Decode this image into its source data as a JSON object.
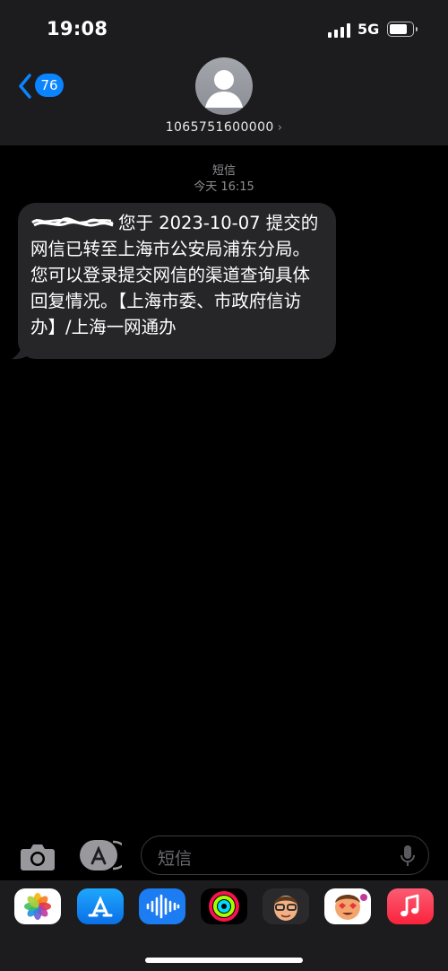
{
  "status_bar": {
    "time": "19:08",
    "network": "5G",
    "battery_level": 0.82
  },
  "nav": {
    "back_count": "76",
    "contact": "1065751600000",
    "contact_chevron": "›"
  },
  "thread": {
    "service": "短信",
    "timestamp": "今天 16:15",
    "message": "您于 2023-10-07 提交的网信已转至上海市公安局浦东分局。您可以登录提交网信的渠道查询具体回复情况。【上海市委、市政府信访办】/上海一网通办"
  },
  "input": {
    "placeholder": "短信"
  },
  "icons": {
    "back": "chevron-left-icon",
    "camera": "camera-icon",
    "apps": "app-store-icon",
    "mic": "microphone-icon"
  },
  "app_drawer": [
    "photos",
    "app-store",
    "audio-messages",
    "fitness-activity",
    "memoji",
    "memoji-stickers",
    "music"
  ],
  "colors": {
    "accent": "#0a84ff",
    "bubble": "#262628",
    "header": "#1c1c1e"
  }
}
